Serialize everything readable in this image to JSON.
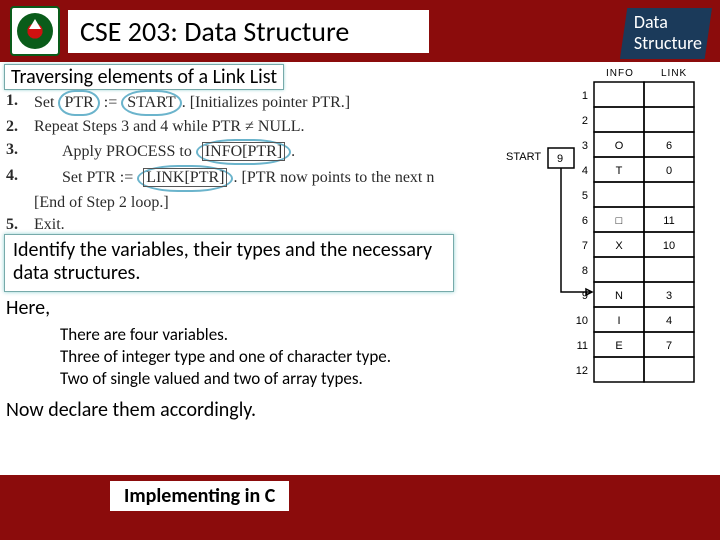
{
  "header": {
    "title": "CSE 203: Data Structure",
    "badge_line1": "Data",
    "badge_line2": "Structure"
  },
  "section_title": "Traversing elements of a Link List",
  "algo": {
    "s1_num": "1.",
    "s1_a": "Set ",
    "s1_ptr": "PTR",
    "s1_b": " := ",
    "s1_start": "START",
    "s1_c": ". [Initializes pointer PTR.]",
    "s2_num": "2.",
    "s2": "Repeat Steps 3 and 4 while PTR ≠ NULL.",
    "s3_num": "3.",
    "s3_a": "Apply PROCESS to ",
    "s3_info": "INFO[PTR]",
    "s3_b": ".",
    "s4_num": "4.",
    "s4_a": "Set PTR := ",
    "s4_link": "LINK[PTR]",
    "s4_b": ". [PTR now points to the next n",
    "s5": "[End of Step 2 loop.]",
    "s6_num": "5.",
    "s6": "Exit."
  },
  "instruction": "Identify the variables, their types and the necessary data structures.",
  "here": "Here,",
  "notes": {
    "n1": "There are four variables.",
    "n2": "Three of integer type and one of character type.",
    "n3": "Two of single valued and two of array types."
  },
  "declare": "Now declare them accordingly.",
  "footer": {
    "impl": "Implementing in C"
  },
  "diagram": {
    "col_info": "INFO",
    "col_link": "LINK",
    "start_label": "START",
    "start_val": "9",
    "rows": [
      {
        "i": "1",
        "info": "",
        "link": ""
      },
      {
        "i": "2",
        "info": "",
        "link": ""
      },
      {
        "i": "3",
        "info": "O",
        "link": "6"
      },
      {
        "i": "4",
        "info": "T",
        "link": "0"
      },
      {
        "i": "5",
        "info": "",
        "link": ""
      },
      {
        "i": "6",
        "info": "□",
        "link": "11"
      },
      {
        "i": "7",
        "info": "X",
        "link": "10"
      },
      {
        "i": "8",
        "info": "",
        "link": ""
      },
      {
        "i": "9",
        "info": "N",
        "link": "3"
      },
      {
        "i": "10",
        "info": "I",
        "link": "4"
      },
      {
        "i": "11",
        "info": "E",
        "link": "7"
      },
      {
        "i": "12",
        "info": "",
        "link": ""
      }
    ]
  }
}
